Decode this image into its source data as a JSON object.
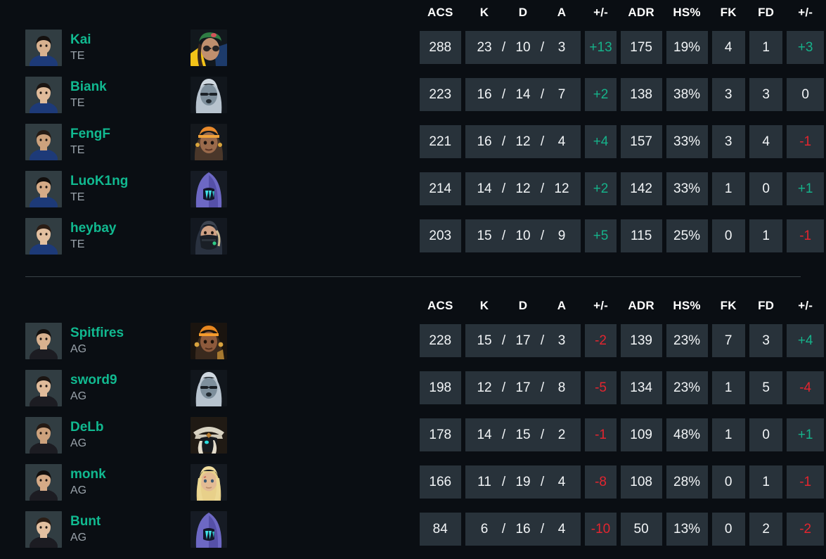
{
  "columns": {
    "player": "",
    "agent": "",
    "stats": [
      "ACS",
      "K",
      "D",
      "A",
      "+/-",
      "ADR",
      "HS%",
      "FK",
      "FD",
      "+/-"
    ]
  },
  "teams": [
    {
      "id": "team-te",
      "tag": "TE",
      "headers": [
        "ACS",
        "K",
        "D",
        "A",
        "+/-",
        "ADR",
        "HS%",
        "FK",
        "FD",
        "+/-"
      ],
      "players": [
        {
          "name": "Kai",
          "team": "TE",
          "agent": "viper-agent",
          "acs": "288",
          "k": "23",
          "d": "10",
          "a": "3",
          "kd_diff": "+13",
          "kd_diff_sign": "pos",
          "adr": "175",
          "hs": "19%",
          "fk": "4",
          "fd": "1",
          "fk_diff": "+3",
          "fk_diff_sign": "pos"
        },
        {
          "name": "Biank",
          "team": "TE",
          "agent": "fade-agent",
          "acs": "223",
          "k": "16",
          "d": "14",
          "a": "7",
          "kd_diff": "+2",
          "kd_diff_sign": "pos",
          "adr": "138",
          "hs": "38%",
          "fk": "3",
          "fd": "3",
          "fk_diff": "0",
          "fk_diff_sign": "zero"
        },
        {
          "name": "FengF",
          "team": "TE",
          "agent": "neon-agent",
          "acs": "221",
          "k": "16",
          "d": "12",
          "a": "4",
          "kd_diff": "+4",
          "kd_diff_sign": "pos",
          "adr": "157",
          "hs": "33%",
          "fk": "3",
          "fd": "4",
          "fk_diff": "-1",
          "fk_diff_sign": "neg"
        },
        {
          "name": "LuoK1ng",
          "team": "TE",
          "agent": "omen-agent",
          "acs": "214",
          "k": "14",
          "d": "12",
          "a": "12",
          "kd_diff": "+2",
          "kd_diff_sign": "pos",
          "adr": "142",
          "hs": "33%",
          "fk": "1",
          "fd": "0",
          "fk_diff": "+1",
          "fk_diff_sign": "pos"
        },
        {
          "name": "heybay",
          "team": "TE",
          "agent": "viper-mask-agent",
          "acs": "203",
          "k": "15",
          "d": "10",
          "a": "9",
          "kd_diff": "+5",
          "kd_diff_sign": "pos",
          "adr": "115",
          "hs": "25%",
          "fk": "0",
          "fd": "1",
          "fk_diff": "-1",
          "fk_diff_sign": "neg"
        }
      ]
    },
    {
      "id": "team-ag",
      "tag": "AG",
      "headers": [
        "ACS",
        "K",
        "D",
        "A",
        "+/-",
        "ADR",
        "HS%",
        "FK",
        "FD",
        "+/-"
      ],
      "players": [
        {
          "name": "Spitfires",
          "team": "AG",
          "agent": "raze-agent",
          "acs": "228",
          "k": "15",
          "d": "17",
          "a": "3",
          "kd_diff": "-2",
          "kd_diff_sign": "neg",
          "adr": "139",
          "hs": "23%",
          "fk": "7",
          "fd": "3",
          "fk_diff": "+4",
          "fk_diff_sign": "pos"
        },
        {
          "name": "sword9",
          "team": "AG",
          "agent": "fade-agent",
          "acs": "198",
          "k": "12",
          "d": "17",
          "a": "8",
          "kd_diff": "-5",
          "kd_diff_sign": "neg",
          "adr": "134",
          "hs": "23%",
          "fk": "1",
          "fd": "5",
          "fk_diff": "-4",
          "fk_diff_sign": "neg"
        },
        {
          "name": "DeLb",
          "team": "AG",
          "agent": "cypher-agent",
          "acs": "178",
          "k": "14",
          "d": "15",
          "a": "2",
          "kd_diff": "-1",
          "kd_diff_sign": "neg",
          "adr": "109",
          "hs": "48%",
          "fk": "1",
          "fd": "0",
          "fk_diff": "+1",
          "fk_diff_sign": "pos"
        },
        {
          "name": "monk",
          "team": "AG",
          "agent": "breach-agent",
          "acs": "166",
          "k": "11",
          "d": "19",
          "a": "4",
          "kd_diff": "-8",
          "kd_diff_sign": "neg",
          "adr": "108",
          "hs": "28%",
          "fk": "0",
          "fd": "1",
          "fk_diff": "-1",
          "fk_diff_sign": "neg"
        },
        {
          "name": "Bunt",
          "team": "AG",
          "agent": "omen-agent",
          "acs": "84",
          "k": "6",
          "d": "16",
          "a": "4",
          "kd_diff": "-10",
          "kd_diff_sign": "neg",
          "adr": "50",
          "hs": "13%",
          "fk": "0",
          "fd": "2",
          "fk_diff": "-2",
          "fk_diff_sign": "neg"
        }
      ]
    }
  ],
  "colors": {
    "background": "#0a0e13",
    "cell_background": "#28323a",
    "player_name": "#11b990",
    "positive": "#16b28a",
    "negative": "#e3252f",
    "neutral_text": "#f2f5f7",
    "team_tag": "#9aa3ab",
    "divider": "#3a4248"
  }
}
